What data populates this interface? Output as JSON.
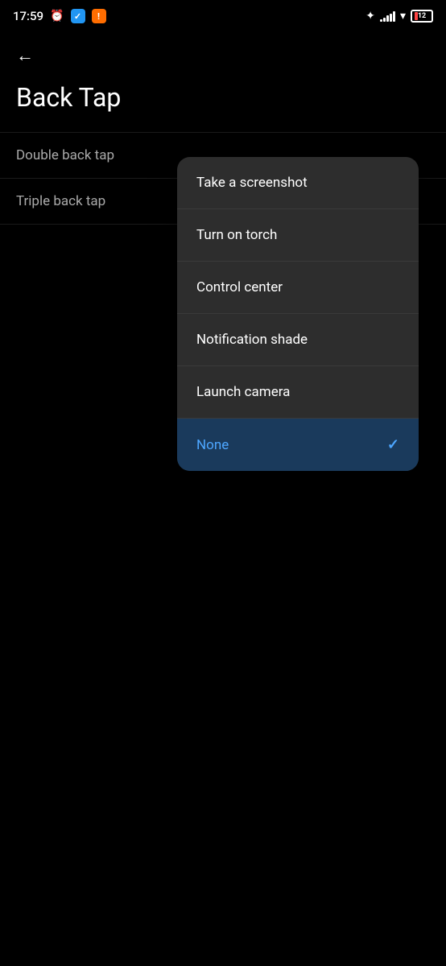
{
  "statusBar": {
    "time": "17:59",
    "batteryLevel": "12",
    "batteryColor": "#ff4444"
  },
  "header": {
    "backLabel": "←",
    "title": "Back Tap"
  },
  "settingsItems": [
    {
      "label": "Double back tap",
      "id": "double-back-tap"
    },
    {
      "label": "Triple back tap",
      "id": "triple-back-tap"
    }
  ],
  "dropdown": {
    "items": [
      {
        "label": "Take a screenshot",
        "selected": false,
        "id": "take-screenshot"
      },
      {
        "label": "Turn on torch",
        "selected": false,
        "id": "turn-on-torch"
      },
      {
        "label": "Control center",
        "selected": false,
        "id": "control-center"
      },
      {
        "label": "Notification shade",
        "selected": false,
        "id": "notification-shade"
      },
      {
        "label": "Launch camera",
        "selected": false,
        "id": "launch-camera"
      },
      {
        "label": "None",
        "selected": true,
        "id": "none"
      }
    ]
  }
}
